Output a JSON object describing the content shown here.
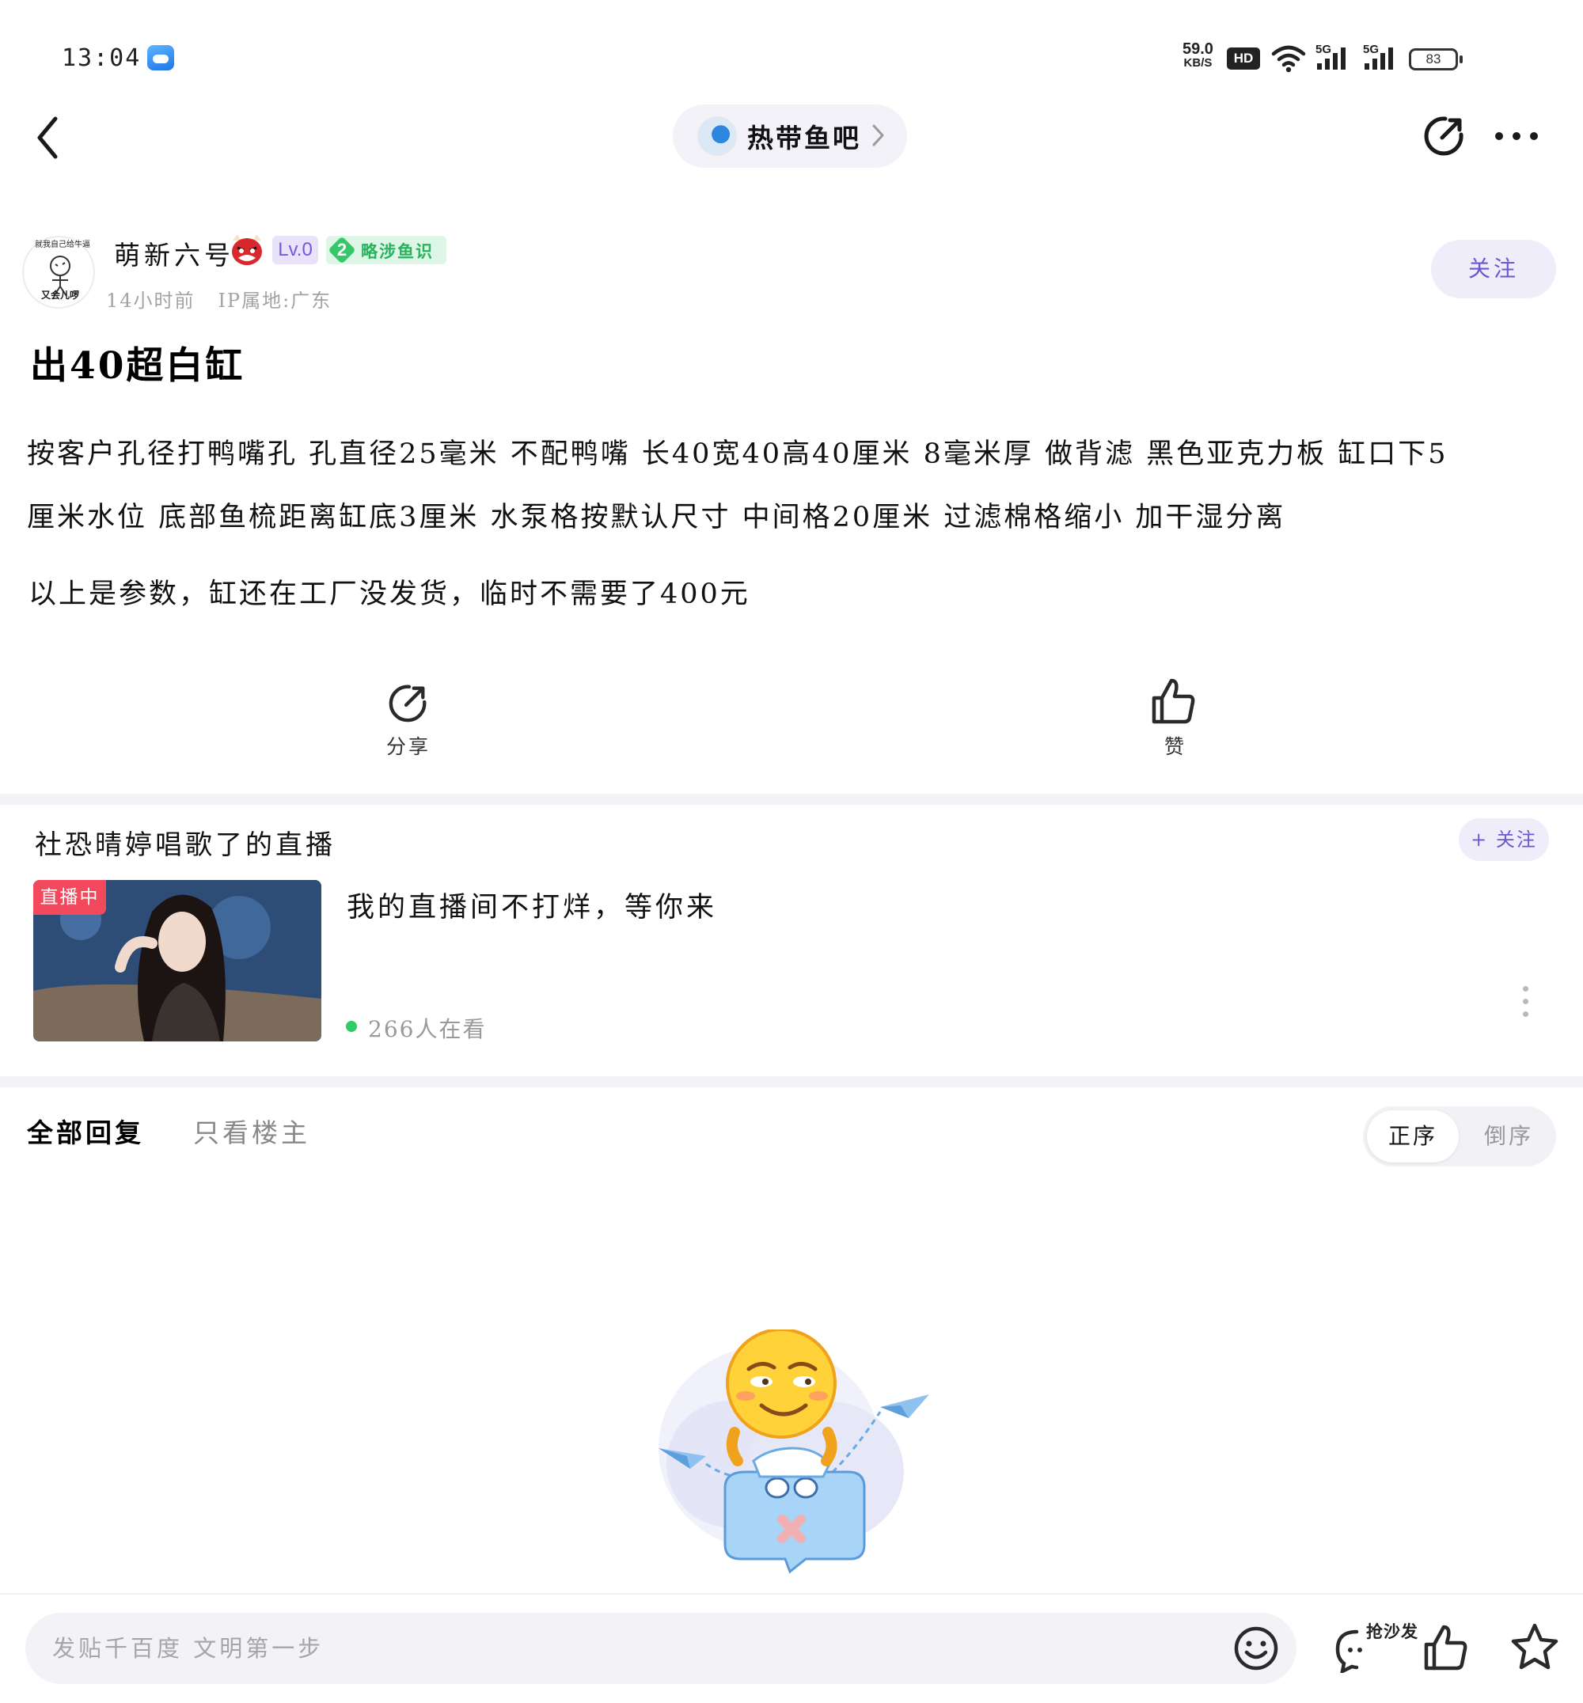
{
  "status_bar": {
    "time": "13:04",
    "net_speed_value": "59.0",
    "net_speed_unit": "KB/S",
    "hd_label": "HD",
    "signal_label_1": "5G",
    "signal_label_2": "5G",
    "battery": "83"
  },
  "nav": {
    "forum_name": "热带鱼吧"
  },
  "author": {
    "avatar_text_top": "就我自己给牛逼",
    "avatar_text_bottom": "又会儿啰",
    "name": "萌新六号",
    "level": "Lv.0",
    "rank_number": "2",
    "rank_title": "略涉鱼识",
    "time": "14小时前",
    "ip_location": "IP属地:广东",
    "follow_label": "关注"
  },
  "post": {
    "title": "出40超白缸",
    "body_line1": "按客户孔径打鸭嘴孔 孔直径25毫米 不配鸭嘴 长40宽40高40厘米 8毫米厚 做背滤 黑色亚克力板 缸口下5",
    "body_line2": "厘米水位 底部鱼梳距离缸底3厘米 水泵格按默认尺寸 中间格20厘米 过滤棉格缩小 加干湿分离",
    "body_para2": "以上是参数，缸还在工厂没发货，临时不需要了400元",
    "share_label": "分享",
    "like_label": "赞"
  },
  "live": {
    "title": "社恐晴婷唱歌了的直播",
    "follow_label": "+ 关注",
    "badge": "直播中",
    "description": "我的直播间不打烊，等你来",
    "viewers": "266人在看"
  },
  "replies": {
    "tab_all": "全部回复",
    "tab_op_only": "只看楼主",
    "sort_asc": "正序",
    "sort_desc": "倒序"
  },
  "bottom_bar": {
    "input_placeholder": "发贴千百度 文明第一步",
    "sofa_label": "抢沙发"
  },
  "colors": {
    "accent": "#6e55d6",
    "accent_bg": "#efedfa",
    "live_red": "#f2495d",
    "online_green": "#2fcd64",
    "rank_green": "#27b35c"
  }
}
